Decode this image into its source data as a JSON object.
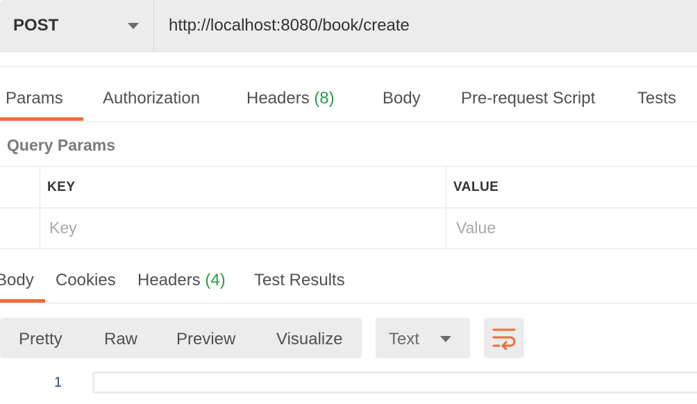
{
  "request": {
    "method": "POST",
    "url": "http://localhost:8080/book/create"
  },
  "request_tabs": [
    {
      "label": "Params",
      "active": true
    },
    {
      "label": "Authorization"
    },
    {
      "label": "Headers",
      "count": "(8)"
    },
    {
      "label": "Body"
    },
    {
      "label": "Pre-request Script"
    },
    {
      "label": "Tests"
    }
  ],
  "query_params": {
    "title": "Query Params",
    "columns": [
      "KEY",
      "VALUE"
    ],
    "placeholders": {
      "key": "Key",
      "value": "Value"
    }
  },
  "response_tabs": [
    {
      "label": "Body",
      "active": true
    },
    {
      "label": "Cookies"
    },
    {
      "label": "Headers",
      "count": "(4)"
    },
    {
      "label": "Test Results"
    }
  ],
  "view_modes": [
    "Pretty",
    "Raw",
    "Preview",
    "Visualize"
  ],
  "format": {
    "selected": "Text"
  },
  "icons": {
    "method_dropdown": "chevron-down-icon",
    "format_dropdown": "chevron-down-icon",
    "wrap": "wrap-lines-icon"
  },
  "editor": {
    "line_numbers": [
      "1"
    ]
  },
  "colors": {
    "accent": "#f26b3a",
    "count": "#2b9a49"
  }
}
